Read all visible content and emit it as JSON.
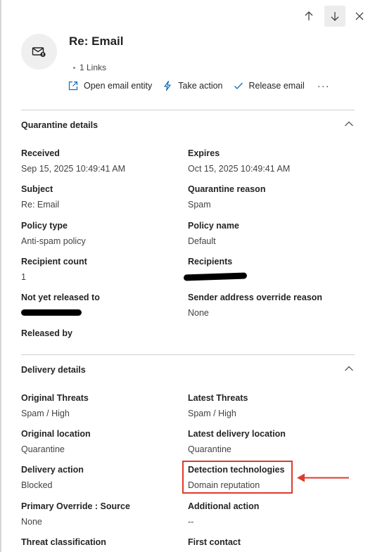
{
  "header": {
    "title": "Re: Email",
    "links_count": "1 Links",
    "actions": {
      "open_entity": "Open email entity",
      "take_action": "Take action",
      "release_email": "Release email",
      "more": "···"
    }
  },
  "quarantine": {
    "title": "Quarantine details",
    "received_label": "Received",
    "received_value": "Sep 15, 2025 10:49:41 AM",
    "expires_label": "Expires",
    "expires_value": "Oct 15, 2025 10:49:41 AM",
    "subject_label": "Subject",
    "subject_value": "Re: Email",
    "reason_label": "Quarantine reason",
    "reason_value": "Spam",
    "policy_type_label": "Policy type",
    "policy_type_value": "Anti-spam policy",
    "policy_name_label": "Policy name",
    "policy_name_value": "Default",
    "recipient_count_label": "Recipient count",
    "recipient_count_value": "1",
    "recipients_label": "Recipients",
    "not_released_label": "Not yet released to",
    "override_reason_label": "Sender address override reason",
    "override_reason_value": "None",
    "released_by_label": "Released by"
  },
  "delivery": {
    "title": "Delivery details",
    "orig_threats_label": "Original Threats",
    "orig_threats_value": "Spam / High",
    "latest_threats_label": "Latest Threats",
    "latest_threats_value": "Spam / High",
    "orig_location_label": "Original location",
    "orig_location_value": "Quarantine",
    "latest_location_label": "Latest delivery location",
    "latest_location_value": "Quarantine",
    "delivery_action_label": "Delivery action",
    "delivery_action_value": "Blocked",
    "detection_tech_label": "Detection technologies",
    "detection_tech_value": "Domain reputation",
    "primary_override_label": "Primary Override : Source",
    "primary_override_value": "None",
    "additional_action_label": "Additional action",
    "additional_action_value": "--",
    "threat_class_label": "Threat classification",
    "first_contact_label": "First contact"
  },
  "colors": {
    "accent": "#0f6cbd",
    "highlight": "#e03a2c"
  },
  "icons": [
    "arrow-up-icon",
    "arrow-down-icon",
    "close-icon",
    "email-icon",
    "open-entity-icon",
    "flash-icon",
    "checkmark-icon",
    "chevron-up-icon"
  ]
}
